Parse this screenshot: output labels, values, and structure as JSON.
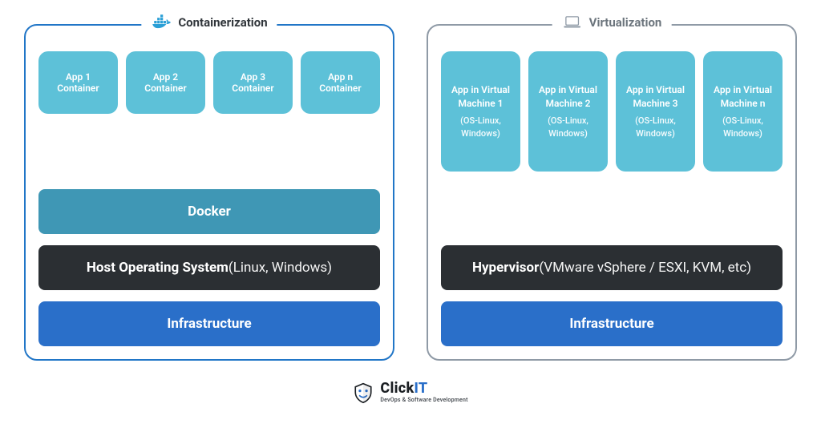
{
  "left": {
    "title": "Containerization",
    "icon": "docker-icon",
    "apps": [
      {
        "line1": "App 1",
        "line2": "Container"
      },
      {
        "line1": "App 2",
        "line2": "Container"
      },
      {
        "line1": "App 3",
        "line2": "Container"
      },
      {
        "line1": "App n",
        "line2": "Container"
      }
    ],
    "docker_label": "Docker",
    "os_bold": "Host Operating System",
    "os_light": " (Linux, Windows)",
    "infra_label": "Infrastructure"
  },
  "right": {
    "title": "Virtualization",
    "icon": "laptop-icon",
    "apps": [
      {
        "line1": "App in Virtual Machine 1",
        "sub": "(OS-Linux, Windows)"
      },
      {
        "line1": "App in Virtual Machine 2",
        "sub": "(OS-Linux, Windows)"
      },
      {
        "line1": "App in Virtual Machine 3",
        "sub": "(OS-Linux, Windows)"
      },
      {
        "line1": "App in Virtual Machine n",
        "sub": "(OS-Linux, Windows)"
      }
    ],
    "hyp_bold": "Hypervisor",
    "hyp_light": " (VMware vSphere / ESXI, KVM, etc)",
    "infra_label": "Infrastructure"
  },
  "footer": {
    "brand_a": "Click",
    "brand_b": "IT",
    "tagline": "DevOps & Software Development"
  }
}
